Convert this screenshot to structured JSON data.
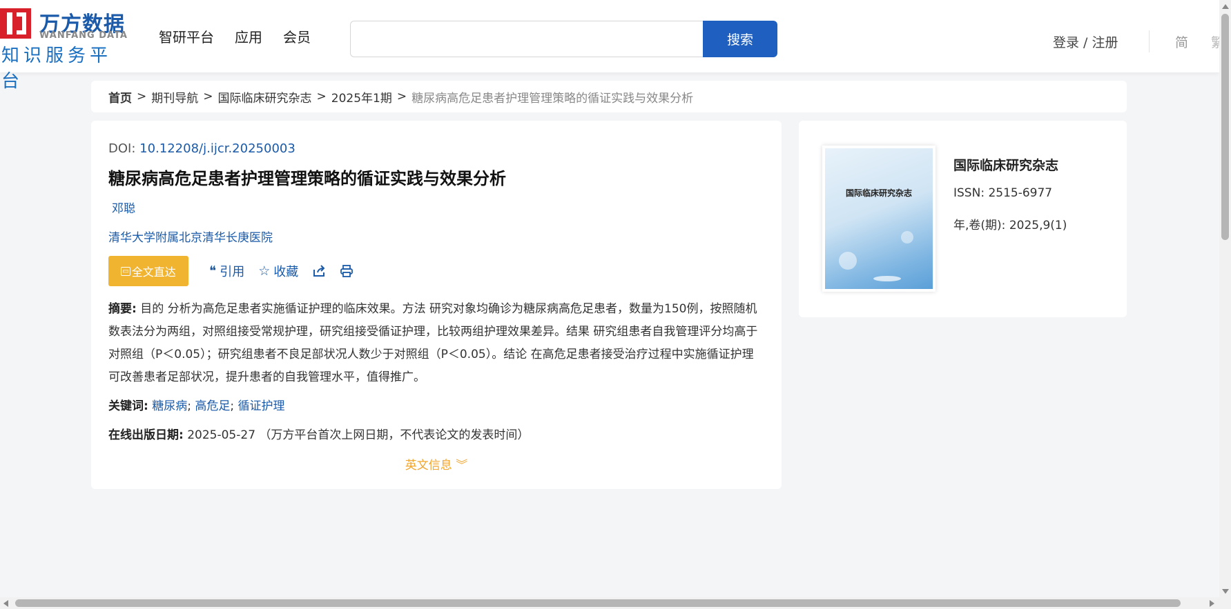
{
  "header": {
    "logo": {
      "cn": "万方数据",
      "en": "WANFANG DATA",
      "sub": "知识服务平台"
    },
    "nav": [
      "智研平台",
      "应用",
      "会员"
    ],
    "search": {
      "value": "",
      "placeholder": "",
      "button": "搜索"
    },
    "login": "登录 / 注册",
    "lang_simplified": "简",
    "lang_traditional": "繁"
  },
  "breadcrumb": {
    "home": "首页",
    "items": [
      "期刊导航",
      "国际临床研究杂志",
      "2025年1期"
    ],
    "current": "糖尿病高危足患者护理管理策略的循证实践与效果分析",
    "separator": ">"
  },
  "article": {
    "doi_label": "DOI:",
    "doi": "10.12208/j.ijcr.20250003",
    "title": "糖尿病高危足患者护理管理策略的循证实践与效果分析",
    "author": "邓聪",
    "organization": "清华大学附属北京清华长庚医院",
    "actions": {
      "fulltext": "全文直达",
      "cite": "引用",
      "favorite": "收藏"
    },
    "abstract_label": "摘要:",
    "abstract": "目的 分析为高危足患者实施循证护理的临床效果。方法 研究对象均确诊为糖尿病高危足患者，数量为150例，按照随机数表法分为两组，对照组接受常规护理，研究组接受循证护理，比较两组护理效果差异。结果 研究组患者自我管理评分均高于对照组（P＜0.05）；研究组患者不良足部状况人数少于对照组（P＜0.05）。结论 在高危足患者接受治疗过程中实施循证护理可改善患者足部状况，提升患者的自我管理水平，值得推广。",
    "keywords_label": "关键词:",
    "keywords": [
      "糖尿病",
      "高危足",
      "循证护理"
    ],
    "pubdate_label": "在线出版日期:",
    "pubdate": "2025-05-27",
    "pubdate_note": "（万方平台首次上网日期，不代表论文的发表时间）",
    "english_info": "英文信息"
  },
  "journal": {
    "cover_title": "国际临床研究杂志",
    "name": "国际临床研究杂志",
    "issn_label": "ISSN:",
    "issn": "2515-6977",
    "volume_label": "年,卷(期):",
    "volume": "2025,9(1)"
  },
  "colors": {
    "brand_red": "#d8202a",
    "brand_blue": "#1a5aa8",
    "search_button": "#1f5fbf",
    "fulltext_button": "#f1b431",
    "english_info": "#f1a52e"
  },
  "icons": [
    "quote-icon",
    "star-icon",
    "share-icon",
    "print-icon",
    "double-chevron-down-icon",
    "free-icon"
  ]
}
